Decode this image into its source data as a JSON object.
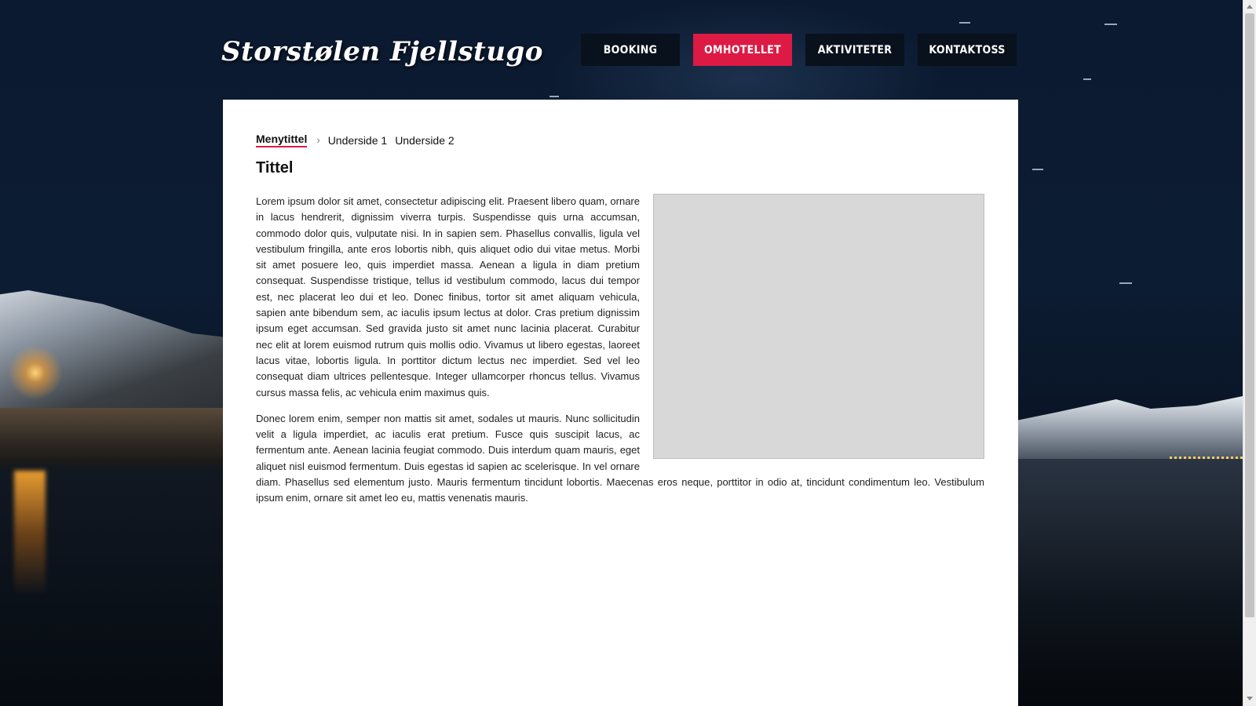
{
  "site": {
    "logo_text": "Storstølen Fjellstugo"
  },
  "nav": {
    "items": [
      {
        "label": "BOOKING",
        "active": false
      },
      {
        "label": "OMHOTELLET",
        "active": true
      },
      {
        "label": "AKTIVITETER",
        "active": false
      },
      {
        "label": "KONTAKTOSS",
        "active": false
      }
    ]
  },
  "breadcrumb": {
    "current": "Menytittel",
    "separator": "›",
    "items": [
      "Underside 1",
      "Underside 2"
    ]
  },
  "page": {
    "title": "Tittel",
    "paragraphs": [
      "Lorem ipsum dolor sit amet, consectetur adipiscing elit. Praesent libero quam, ornare in lacus hendrerit, dignissim viverra turpis. Suspendisse quis urna accumsan, commodo dolor quis, vulputate nisi. In in sapien sem. Phasellus convallis, ligula vel vestibulum fringilla, ante eros lobortis nibh, quis aliquet odio dui vitae metus. Morbi sit amet posuere leo, quis imperdiet massa. Aenean a ligula in diam pretium consequat. Suspendisse tristique, tellus id vestibulum commodo, lacus dui tempor est, nec placerat leo dui et leo. Donec finibus, tortor sit amet aliquam vehicula, sapien ante bibendum sem, ac iaculis ipsum lectus at dolor. Cras pretium dignissim ipsum eget accumsan. Sed gravida justo sit amet nunc lacinia placerat. Curabitur nec elit at lorem euismod rutrum quis mollis odio. Vivamus ut libero egestas, laoreet lacus vitae, lobortis ligula. In porttitor dictum lectus nec imperdiet. Sed vel leo consequat diam ultrices pellentesque. Integer ullamcorper rhoncus tellus. Vivamus cursus massa felis, ac vehicula enim maximus quis.",
      "Donec lorem enim, semper non mattis sit amet, sodales ut mauris. Nunc sollicitudin velit a ligula imperdiet, ac iaculis erat pretium. Fusce quis suscipit lacus, ac fermentum ante. Aenean lacinia feugiat commodo. Duis interdum quam mauris, eget aliquet nisl euismod fermentum. Duis egestas id sapien ac scelerisque. In vel ornare diam. Phasellus sed elementum justo. Mauris fermentum tincidunt lobortis. Maecenas eros neque, porttitor in odio at, tincidunt condimentum leo. Vestibulum ipsum enim, ornare sit amet leo eu, mattis venenatis mauris."
    ]
  },
  "colors": {
    "accent": "#dd1a44",
    "nav_bg": "#08111c",
    "placeholder": "#d8d8d8"
  }
}
